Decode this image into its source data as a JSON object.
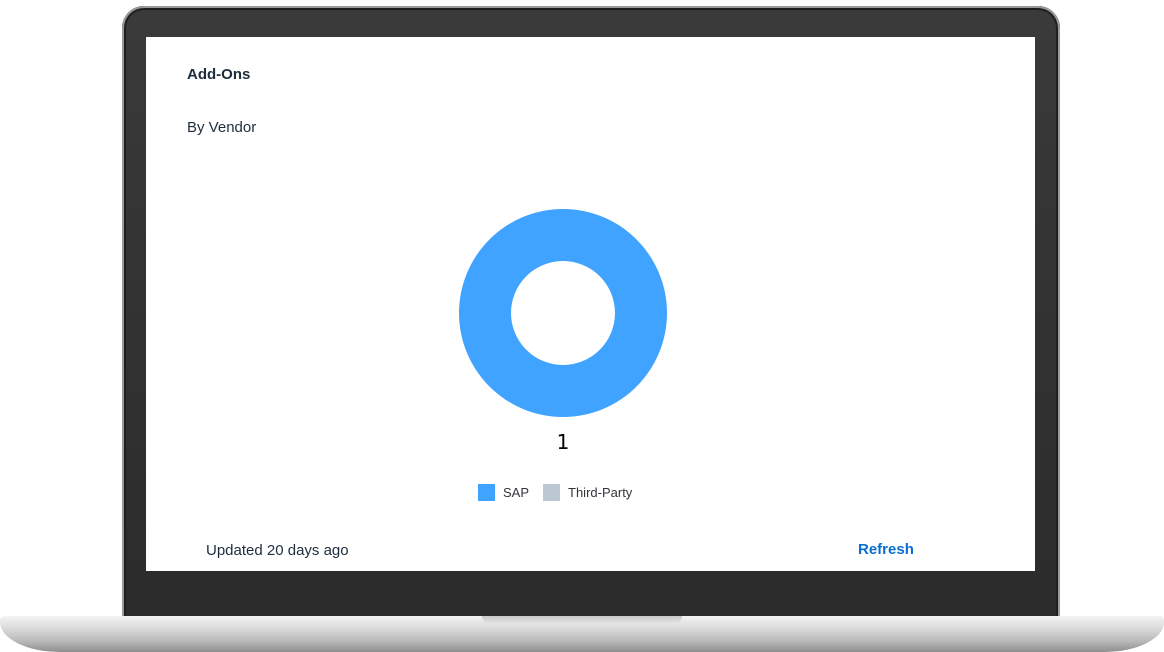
{
  "card": {
    "title": "Add-Ons",
    "subtitle": "By Vendor"
  },
  "chart_data": {
    "type": "pie",
    "style": "donut",
    "categories": [
      "SAP",
      "Third-Party"
    ],
    "values": [
      1,
      0
    ],
    "colors": [
      "#3fa3ff",
      "#bcc7d3"
    ],
    "data_labels": [
      "1"
    ],
    "legend_position": "bottom"
  },
  "legend": {
    "items": [
      {
        "label": "SAP",
        "color": "#3fa3ff"
      },
      {
        "label": "Third-Party",
        "color": "#bcc7d3"
      }
    ]
  },
  "footer": {
    "updated_text": "Updated 20 days ago",
    "refresh_label": "Refresh"
  },
  "colors": {
    "text": "#1d2d3e",
    "link": "#0a6ed1"
  }
}
